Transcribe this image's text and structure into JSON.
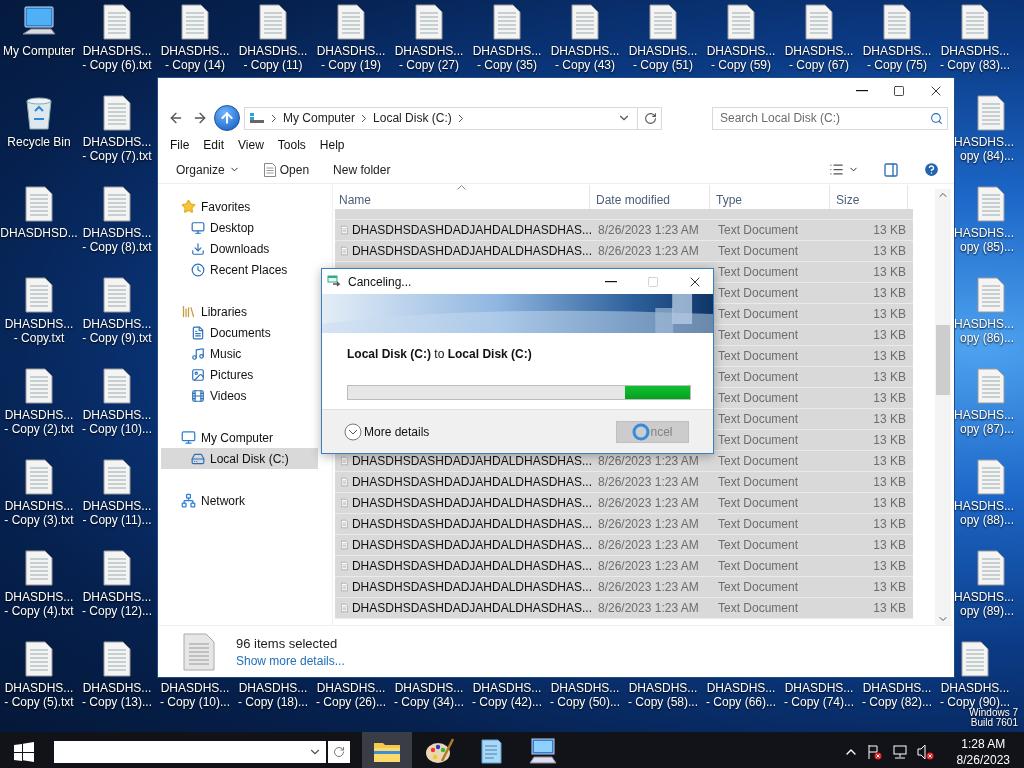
{
  "desktop": {
    "left_columns": [
      [
        {
          "kind": "computer",
          "lines": [
            "My Computer"
          ]
        },
        {
          "kind": "recycle",
          "lines": [
            "Recycle Bin"
          ]
        },
        {
          "kind": "file",
          "lines": [
            "DHASDHSD..."
          ]
        },
        {
          "kind": "file",
          "lines": [
            "DHASDHS...",
            "- Copy.txt"
          ]
        },
        {
          "kind": "file",
          "lines": [
            "DHASDHS...",
            "- Copy (2).txt"
          ]
        },
        {
          "kind": "file",
          "lines": [
            "DHASDHS...",
            "- Copy (3).txt"
          ]
        },
        {
          "kind": "file",
          "lines": [
            "DHASDHS...",
            "- Copy (4).txt"
          ]
        },
        {
          "kind": "file",
          "lines": [
            "DHASDHS...",
            "- Copy (5).txt"
          ]
        }
      ],
      [
        {
          "kind": "file",
          "lines": [
            "DHASDHS...",
            "- Copy (6).txt"
          ]
        },
        {
          "kind": "file",
          "lines": [
            "DHASDHS...",
            "- Copy (7).txt"
          ]
        },
        {
          "kind": "file",
          "lines": [
            "DHASDHS...",
            "- Copy (8).txt"
          ]
        },
        {
          "kind": "file",
          "lines": [
            "DHASDHS...",
            "- Copy (9).txt"
          ]
        },
        {
          "kind": "file",
          "lines": [
            "DHASDHS...",
            "- Copy (10)..."
          ]
        },
        {
          "kind": "file",
          "lines": [
            "DHASDHS...",
            "- Copy (11)..."
          ]
        },
        {
          "kind": "file",
          "lines": [
            "DHASDHS...",
            "- Copy (12)..."
          ]
        },
        {
          "kind": "file",
          "lines": [
            "DHASDHS...",
            "- Copy (13)..."
          ]
        }
      ]
    ],
    "top_row": [
      {
        "kind": "file",
        "lines": [
          "DHASDHS...",
          "- Copy (14)"
        ]
      },
      {
        "kind": "file",
        "lines": [
          "DHASDHS...",
          "- Copy (11)"
        ]
      },
      {
        "kind": "file",
        "lines": [
          "DHASDHS...",
          "- Copy (19)"
        ]
      },
      {
        "kind": "file",
        "lines": [
          "DHASDHS...",
          "- Copy (27)"
        ]
      },
      {
        "kind": "file",
        "lines": [
          "DHASDHS...",
          "- Copy (35)"
        ]
      },
      {
        "kind": "file",
        "lines": [
          "DHASDHS...",
          "- Copy (43)"
        ]
      },
      {
        "kind": "file",
        "lines": [
          "DHASDHS...",
          "- Copy (51)"
        ]
      },
      {
        "kind": "file",
        "lines": [
          "DHASDHS...",
          "- Copy (59)"
        ]
      },
      {
        "kind": "file",
        "lines": [
          "DHASDHS...",
          "- Copy (67)"
        ]
      },
      {
        "kind": "file",
        "lines": [
          "DHASDHS...",
          "- Copy (75)"
        ]
      },
      {
        "kind": "file",
        "lines": [
          "DHASDHS...",
          "- Copy (83)..."
        ]
      }
    ],
    "right_column": [
      {
        "kind": "file",
        "lines": [
          "HASDHS...",
          "opy (84)..."
        ]
      },
      {
        "kind": "file",
        "lines": [
          "HASDHS...",
          "opy (85)..."
        ]
      },
      {
        "kind": "file",
        "lines": [
          "HASDHS...",
          "opy (86)..."
        ]
      },
      {
        "kind": "file",
        "lines": [
          "HASDHS...",
          "opy (87)..."
        ]
      },
      {
        "kind": "file",
        "lines": [
          "HASDHS...",
          "opy (88)..."
        ]
      },
      {
        "kind": "file",
        "lines": [
          "HASDHS...",
          "opy (89)..."
        ]
      }
    ],
    "bottom_row": [
      {
        "kind": "label",
        "lines": [
          "DHASDHS...",
          "- Copy (10)..."
        ]
      },
      {
        "kind": "label",
        "lines": [
          "DHASDHS...",
          "- Copy (18)..."
        ]
      },
      {
        "kind": "label",
        "lines": [
          "DHASDHS...",
          "- Copy (26)..."
        ]
      },
      {
        "kind": "label",
        "lines": [
          "DHASDHS...",
          "- Copy (34)..."
        ]
      },
      {
        "kind": "label",
        "lines": [
          "DHASDHS...",
          "- Copy (42)..."
        ]
      },
      {
        "kind": "label",
        "lines": [
          "DHASDHS...",
          "- Copy (50)..."
        ]
      },
      {
        "kind": "label",
        "lines": [
          "DHASDHS...",
          "- Copy (58)..."
        ]
      },
      {
        "kind": "label",
        "lines": [
          "DHASDHS...",
          "- Copy (66)..."
        ]
      },
      {
        "kind": "label",
        "lines": [
          "DHASDHS...",
          "- Copy (74)..."
        ]
      },
      {
        "kind": "label",
        "lines": [
          "DHASDHS...",
          "- Copy (82)..."
        ]
      },
      {
        "kind": "file",
        "lines": [
          "DHASDHS...",
          "- Copy (90)..."
        ]
      }
    ],
    "os_label": [
      "Windows 7",
      "Build 7601"
    ]
  },
  "explorer": {
    "address": [
      "My Computer",
      "Local Disk (C:)"
    ],
    "search": {
      "placeholder": "Search Local Disk (C:)"
    },
    "menu": [
      "File",
      "Edit",
      "View",
      "Tools",
      "Help"
    ],
    "commands": [
      {
        "label": "Organize",
        "kind": "menu"
      },
      {
        "label": "Open",
        "kind": "open"
      },
      {
        "label": "New folder",
        "kind": "plain"
      }
    ],
    "navigation": [
      {
        "label": "Favorites",
        "selected": false,
        "children": [
          {
            "label": "Desktop",
            "selected": false
          },
          {
            "label": "Downloads",
            "selected": false
          },
          {
            "label": "Recent Places",
            "selected": false
          }
        ]
      },
      {
        "label": "Libraries",
        "selected": false,
        "children": [
          {
            "label": "Documents",
            "selected": false
          },
          {
            "label": "Music",
            "selected": false
          },
          {
            "label": "Pictures",
            "selected": false
          },
          {
            "label": "Videos",
            "selected": false
          }
        ]
      },
      {
        "label": "My Computer",
        "selected": false,
        "children": [
          {
            "label": "Local Disk (C:)",
            "selected": true
          }
        ]
      },
      {
        "label": "Network",
        "selected": false
      }
    ],
    "columns": [
      {
        "label": "Name",
        "sorted": true
      },
      {
        "label": "Date modified",
        "sorted": false
      },
      {
        "label": "Type",
        "sorted": false
      },
      {
        "label": "Size",
        "sorted": false
      }
    ],
    "rows": [
      {
        "selected": true
      },
      {
        "selected": true,
        "name": "DHASDHSDASHDADJAHDALDHASDHAS...",
        "date": "8/26/2023 1:23 AM",
        "type": "Text Document",
        "size": "13 KB"
      },
      {
        "selected": true,
        "name": "DHASDHSDASHDADJAHDALDHASDHAS...",
        "date": "8/26/2023 1:23 AM",
        "type": "Text Document",
        "size": "13 KB"
      },
      {
        "selected": true,
        "type": "Text Document",
        "size": "13 KB"
      },
      {
        "selected": true,
        "type": "Text Document",
        "size": "13 KB"
      },
      {
        "selected": true,
        "type": "Text Document",
        "size": "13 KB"
      },
      {
        "selected": true,
        "type": "Text Document",
        "size": "13 KB"
      },
      {
        "selected": true,
        "type": "Text Document",
        "size": "13 KB"
      },
      {
        "selected": true,
        "type": "Text Document",
        "size": "13 KB"
      },
      {
        "selected": true,
        "type": "Text Document",
        "size": "13 KB"
      },
      {
        "selected": true,
        "type": "Text Document",
        "size": "13 KB"
      },
      {
        "selected": true,
        "type": "Text Document",
        "size": "13 KB"
      },
      {
        "selected": true,
        "name": "DHASDHSDASHDADJAHDALDHASDHAS...",
        "date": "8/26/2023 1:23 AM",
        "type": "Text Document",
        "size": "13 KB"
      },
      {
        "selected": true,
        "name": "DHASDHSDASHDADJAHDALDHASDHAS...",
        "date": "8/26/2023 1:23 AM",
        "type": "Text Document",
        "size": "13 KB"
      },
      {
        "selected": true,
        "name": "DHASDHSDASHDADJAHDALDHASDHAS...",
        "date": "8/26/2023 1:23 AM",
        "type": "Text Document",
        "size": "13 KB"
      },
      {
        "selected": true,
        "name": "DHASDHSDASHDADJAHDALDHASDHAS...",
        "date": "8/26/2023 1:23 AM",
        "type": "Text Document",
        "size": "13 KB"
      },
      {
        "selected": true,
        "name": "DHASDHSDASHDADJAHDALDHASDHAS...",
        "date": "8/26/2023 1:23 AM",
        "type": "Text Document",
        "size": "13 KB"
      },
      {
        "selected": true,
        "name": "DHASDHSDASHDADJAHDALDHASDHAS...",
        "date": "8/26/2023 1:23 AM",
        "type": "Text Document",
        "size": "13 KB"
      },
      {
        "selected": true,
        "name": "DHASDHSDASHDADJAHDALDHASDHAS...",
        "date": "8/26/2023 1:23 AM",
        "type": "Text Document",
        "size": "13 KB"
      },
      {
        "selected": true,
        "name": "DHASDHSDASHDADJAHDALDHASDHAS...",
        "date": "8/26/2023 1:23 AM",
        "type": "Text Document",
        "size": "13 KB"
      }
    ],
    "details": {
      "summary": "96 items selected",
      "link": "Show more details..."
    }
  },
  "dialog": {
    "title": "Canceling...",
    "maximize_disabled": true,
    "description": "**Local Disk (C:)** to **Local Disk (C:)**",
    "progress": {
      "level": 0.19
    },
    "details_toggle": "More details",
    "cancel": {
      "label": "ncel",
      "disabled": true
    }
  },
  "taskbar": {
    "apps": [
      {
        "selected": true
      },
      {
        "selected": false
      },
      {
        "selected": false
      },
      {
        "selected": false
      }
    ],
    "clock": {
      "time": "1:28 AM",
      "date": "8/26/2023"
    }
  }
}
